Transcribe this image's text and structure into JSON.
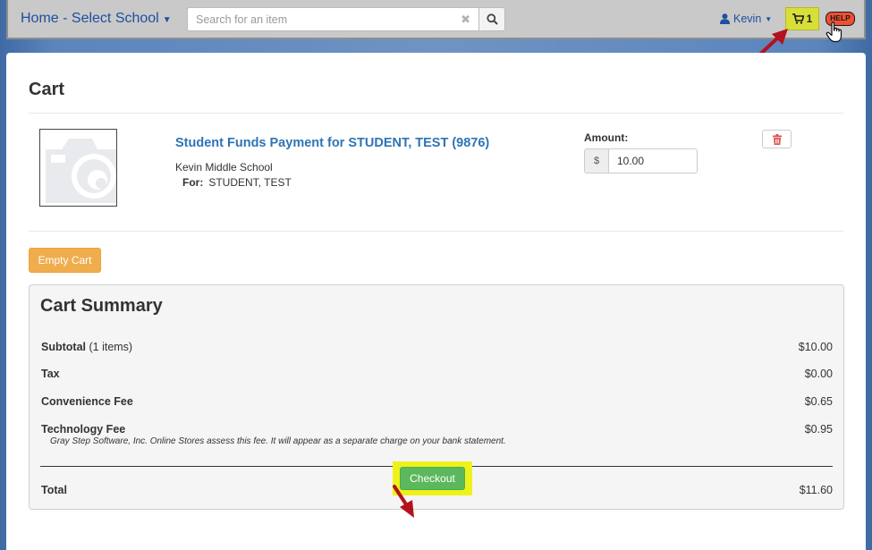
{
  "navbar": {
    "brand_label": "Home - Select School",
    "search_placeholder": "Search for an item",
    "user_name": "Kevin",
    "cart_count": "1",
    "help_label": "HELP"
  },
  "page": {
    "title": "Cart"
  },
  "cart_item": {
    "title": "Student Funds Payment for STUDENT, TEST (9876)",
    "school": "Kevin Middle School",
    "for_label": "For:",
    "for_value": "STUDENT, TEST",
    "amount_label": "Amount:",
    "currency_symbol": "$",
    "amount_value": "10.00"
  },
  "actions": {
    "empty_cart_label": "Empty Cart",
    "checkout_label": "Checkout"
  },
  "summary": {
    "title": "Cart Summary",
    "subtotal_label": "Subtotal",
    "subtotal_qty": "(1 items)",
    "subtotal_value": "$10.00",
    "tax_label": "Tax",
    "tax_value": "$0.00",
    "convenience_label": "Convenience Fee",
    "convenience_value": "$0.65",
    "technology_label": "Technology Fee",
    "technology_value": "$0.95",
    "technology_note": "Gray Step Software, Inc. Online Stores assess this fee. It will appear as a separate charge on your bank statement.",
    "total_label": "Total",
    "total_value": "$11.60"
  },
  "colors": {
    "brand_link": "#1e4fa0",
    "item_link": "#2f74b5",
    "cart_button": "#d9df3a",
    "help_button": "#ef4f32",
    "empty_cart_button": "#f0ad4e",
    "checkout_button": "#5cb85c",
    "checkout_highlight": "#eef21a",
    "annotation_arrow": "#b3121c"
  },
  "icons": {
    "search": "search-icon",
    "clear": "close-icon",
    "user": "user-icon",
    "cart": "cart-icon",
    "delete": "trash-icon",
    "placeholder_image": "camera-icon",
    "pointer": "hand-pointer-icon"
  }
}
